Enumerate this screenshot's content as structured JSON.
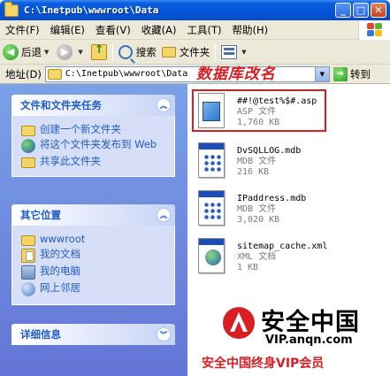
{
  "window": {
    "title": "C:\\Inetpub\\wwwroot\\Data"
  },
  "menu": [
    "文件(F)",
    "编辑(E)",
    "查看(V)",
    "收藏(A)",
    "工具(T)",
    "帮助(H)"
  ],
  "toolbar": {
    "back": "后退",
    "search": "搜索",
    "folders": "文件夹"
  },
  "address": {
    "label": "地址(D)",
    "path": "C:\\Inetpub\\wwwroot\\Data",
    "annotation": "数据库改名",
    "go": "转到"
  },
  "tasks": {
    "title": "文件和文件夹任务",
    "items": [
      "创建一个新文件夹",
      "将这个文件夹发布到 Web",
      "共享此文件夹"
    ]
  },
  "places": {
    "title": "其它位置",
    "items": [
      "wwwroot",
      "我的文档",
      "我的电脑",
      "网上邻居"
    ]
  },
  "details": {
    "title": "详细信息"
  },
  "files": [
    {
      "name": "##!@test%$#.asp",
      "type": "ASP 文件",
      "size": "1,760 KB"
    },
    {
      "name": "DvSQLLOG.mdb",
      "type": "MDB 文件",
      "size": "216 KB"
    },
    {
      "name": "IPaddress.mdb",
      "type": "MDB 文件",
      "size": "3,020 KB"
    },
    {
      "name": "sitemap_cache.xml",
      "type": "XML 文档",
      "size": "1 KB"
    }
  ],
  "watermark": {
    "brand": "安全中国",
    "url": "VIP.anqn.com",
    "slogan": "安全中国终身VIP会员"
  },
  "colors": {
    "titlebar": "#0354d8",
    "link": "#215dc6",
    "annotation": "#d81e23",
    "taskpane": "#6f8ee0"
  }
}
